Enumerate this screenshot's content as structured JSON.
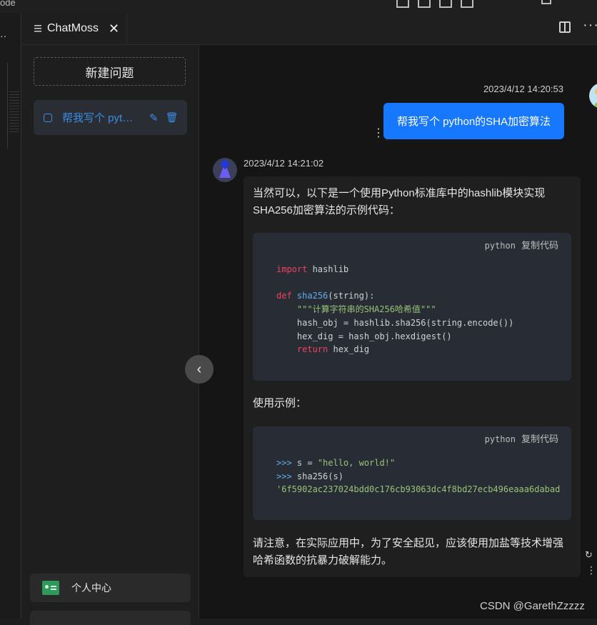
{
  "window": {
    "title_fragment": "ode"
  },
  "tab": {
    "title": "ChatMoss",
    "close_glyph": "✕"
  },
  "sidebar": {
    "new_question_label": "新建问题",
    "conversations": [
      {
        "label": "帮我写个 python的SHA加密算法",
        "icon": "chat-icon"
      }
    ],
    "profile_label": "个人中心"
  },
  "chat": {
    "user_message": {
      "time": "2023/4/12 14:20:53",
      "text": "帮我写个 python的SHA加密算法"
    },
    "bot_message": {
      "time": "2023/4/12 14:21:02",
      "intro": "当然可以，以下是一个使用Python标准库中的hashlib模块实现SHA256加密算法的示例代码：",
      "code1": {
        "lang": "python",
        "copy_label": "复制代码",
        "line1_kw": "import",
        "line1_rest": " hashlib",
        "line3_kw": "def",
        "line3_fn": "sha256",
        "line3_rest": "(string):",
        "line4": "    \"\"\"计算字符串的SHA256哈希值\"\"\"",
        "line5": "    hash_obj = hashlib.sha256(string.encode())",
        "line6": "    hex_dig = hash_obj.hexdigest()",
        "line7_kw": "return",
        "line7_rest": " hex_dig"
      },
      "usage_label": "使用示例：",
      "code2": {
        "lang": "python",
        "copy_label": "复制代码",
        "prompt": ">>>",
        "line1_code": " s = ",
        "line1_str": "\"hello, world!\"",
        "line2_code": " sha256(s)",
        "line3_str": "'6f5902ac237024bdd0c176cb93063dc4f8bd27ecb496eaaa6dabad"
      },
      "note": "请注意，在实际应用中，为了安全起见，应该使用加盐等技术增强哈希函数的抗暴力破解能力。"
    }
  },
  "watermark": "CSDN @GarethZzzzz",
  "colors": {
    "accent": "#1677ff",
    "link": "#3a8ee6",
    "keyword": "#f2415f",
    "function": "#61afef",
    "string": "#98c379"
  }
}
